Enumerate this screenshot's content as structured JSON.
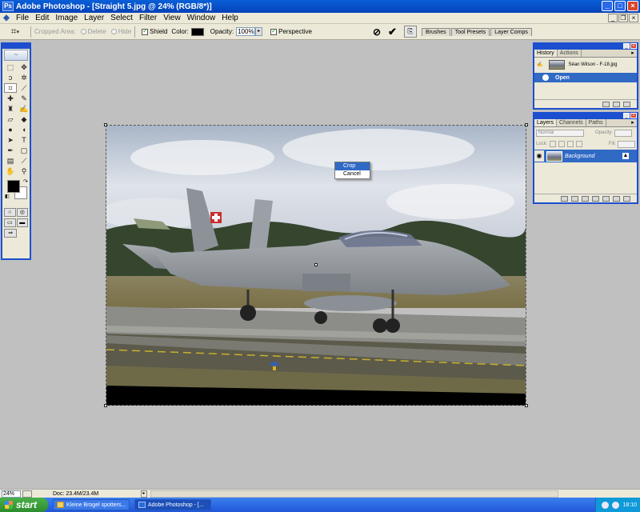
{
  "window": {
    "title": "Adobe Photoshop - [Straight 5.jpg @ 24% (RGB/8*)]",
    "app_icon_label": "Ps",
    "buttons": {
      "minimize": "_",
      "maximize": "□",
      "close": "×"
    }
  },
  "menubar": {
    "items": [
      "File",
      "Edit",
      "Image",
      "Layer",
      "Select",
      "Filter",
      "View",
      "Window",
      "Help"
    ],
    "doc_buttons": {
      "minimize": "_",
      "restore": "❐",
      "close": "×"
    }
  },
  "options": {
    "cropped_area_label": "Cropped Area:",
    "delete_label": "Delete",
    "hide_label": "Hide",
    "shield_label": "Shield",
    "color_label": "Color:",
    "opacity_label": "Opacity:",
    "opacity_value": "100%",
    "perspective_label": "Perspective",
    "shield_checked": true,
    "perspective_checked": true,
    "shield_color": "#000000",
    "cancel_icon": "cancel-icon",
    "commit_icon": "commit-icon"
  },
  "palette_well": [
    "Brushes",
    "Tool Presets",
    "Layer Comps"
  ],
  "context_menu": {
    "items": [
      {
        "label": "Crop",
        "highlighted": true
      },
      {
        "label": "Cancel",
        "highlighted": false
      }
    ]
  },
  "history": {
    "tabs": [
      "History",
      "Actions"
    ],
    "snapshot": "Séan Wilson - F-18.jpg",
    "states": [
      {
        "label": "Open",
        "selected": true
      }
    ]
  },
  "layers": {
    "tabs": [
      "Layers",
      "Channels",
      "Paths"
    ],
    "blend_mode": "Normal",
    "opacity_label": "Opacity:",
    "lock_label": "Lock:",
    "fill_label": "Fill:",
    "rows": [
      {
        "name": "Background",
        "visible": true,
        "locked": true
      }
    ]
  },
  "status": {
    "zoom": "24%",
    "doc": "Doc: 23.4M/23.4M"
  },
  "taskbar": {
    "start_label": "start",
    "tasks": [
      {
        "label": "Kleine Brogel spotters...",
        "active": false
      },
      {
        "label": "Adobe Photoshop - [...",
        "active": true
      }
    ],
    "clock": "18:10"
  },
  "colors": {
    "title_blue": "#0a5fd8",
    "panel_border": "#1b4fd0",
    "selection": "#316ac5",
    "chrome": "#ece9d8",
    "canvas_bg": "#c0c0c0"
  }
}
